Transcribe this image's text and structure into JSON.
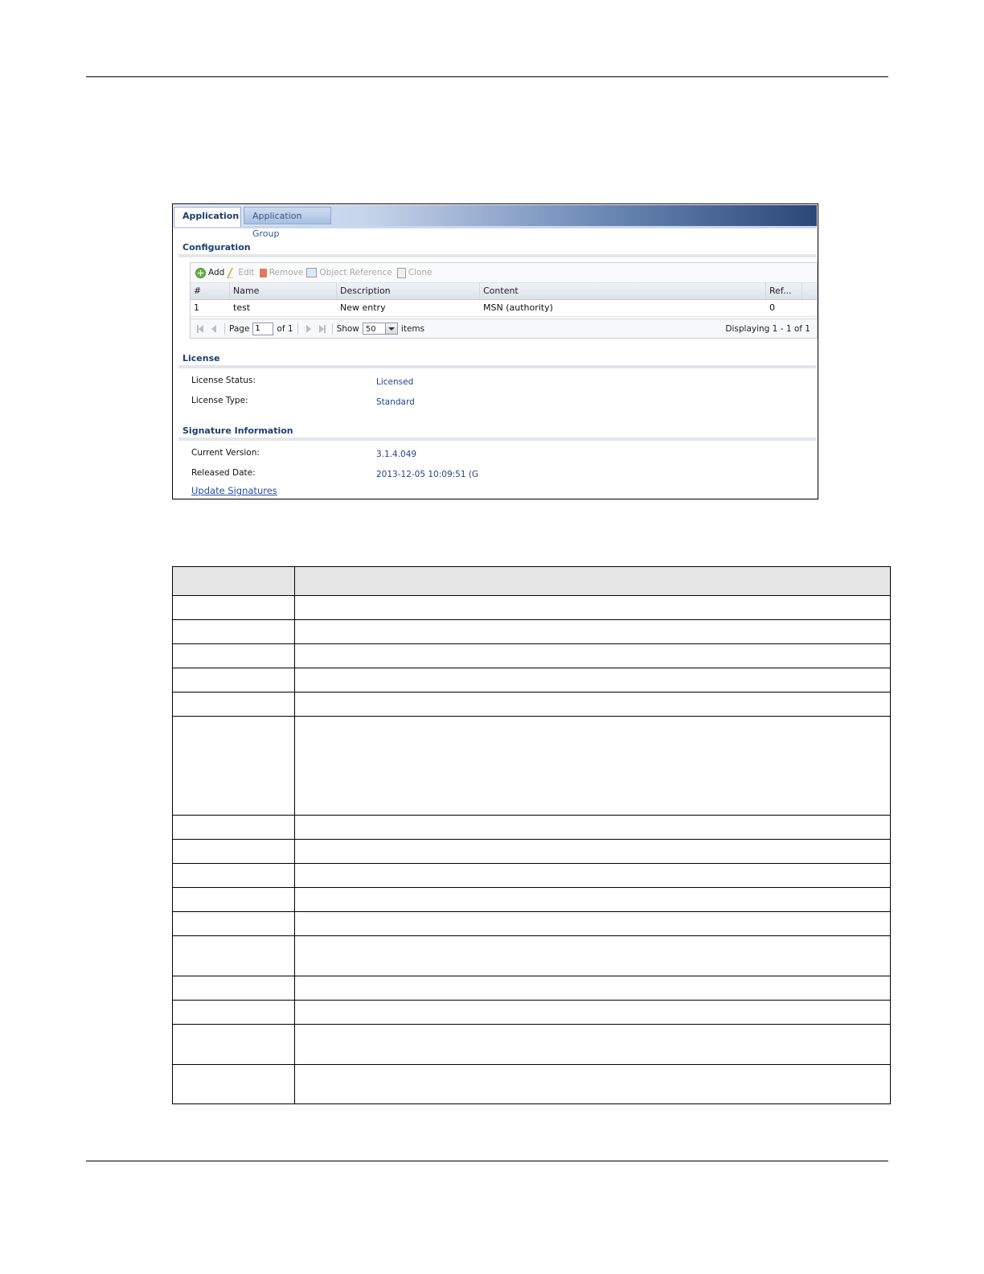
{
  "tabs": [
    {
      "label": "Application",
      "active": true
    },
    {
      "label": "Application Group",
      "active": false
    }
  ],
  "configuration": {
    "title": "Configuration",
    "toolbar": {
      "add": "Add",
      "edit": "Edit",
      "remove": "Remove",
      "object_reference": "Object Reference",
      "clone": "Clone"
    },
    "columns": [
      "#",
      "Name",
      "Description",
      "Content",
      "Ref..."
    ],
    "rows": [
      {
        "index": "1",
        "name": "test",
        "description": "New entry",
        "content": "MSN (authority)",
        "ref": "0"
      }
    ],
    "pager": {
      "page_label": "Page",
      "page_value": "1",
      "of_label": "of 1",
      "show_label": "Show",
      "show_value": "50",
      "items_label": "items",
      "displaying": "Displaying 1 - 1 of 1"
    }
  },
  "license": {
    "title": "License",
    "status_label": "License Status:",
    "status_value": "Licensed",
    "type_label": "License Type:",
    "type_value": "Standard"
  },
  "signature": {
    "title": "Signature Information",
    "version_label": "Current Version:",
    "version_value": "3.1.4.049",
    "date_label": "Released Date:",
    "date_value": "2013-12-05 10:09:51 (G",
    "update_link": "Update Signatures"
  },
  "colors": {
    "tab_active_text": "#1c3c6c",
    "section_title": "#1d3f70",
    "value_text": "#22448a",
    "link": "#2550a8"
  }
}
